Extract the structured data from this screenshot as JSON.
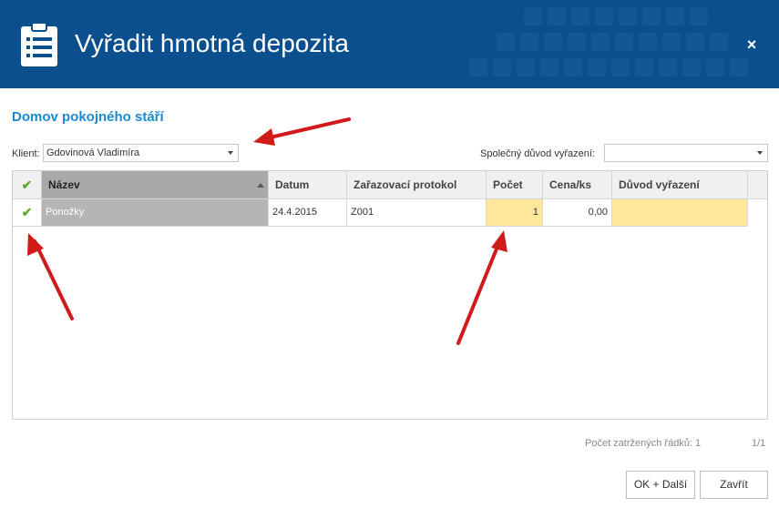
{
  "window": {
    "title": "Vyřadit hmotná depozita",
    "close_label": "×"
  },
  "facility": "Domov pokojného stáří",
  "client": {
    "label": "Klient:",
    "value": "Gdovinová Vladimíra"
  },
  "shared_reason": {
    "label": "Společný důvod vyřazení:",
    "value": ""
  },
  "grid": {
    "columns": [
      "Název",
      "Datum",
      "Zařazovací protokol",
      "Počet",
      "Cena/ks",
      "Důvod vyřazení"
    ],
    "check_header": "✔",
    "rows": [
      {
        "checked": "✔",
        "nazev": "Ponožky",
        "datum": "24.4.2015",
        "protokol": "Z001",
        "pocet": "1",
        "cena": "0,00",
        "duvod": ""
      }
    ]
  },
  "footer": {
    "checked_rows": "Počet zatržených řádků: 1",
    "pages": "1/1"
  },
  "buttons": {
    "ok_next": "OK + Další",
    "close": "Zavřít"
  },
  "colors": {
    "header": "#0b4f8e",
    "accent": "#1a8bd0",
    "editable": "#fee69a",
    "selected": "#b5b5b5",
    "check": "#5cae2f",
    "annotation_arrow": "#d11a1a"
  }
}
